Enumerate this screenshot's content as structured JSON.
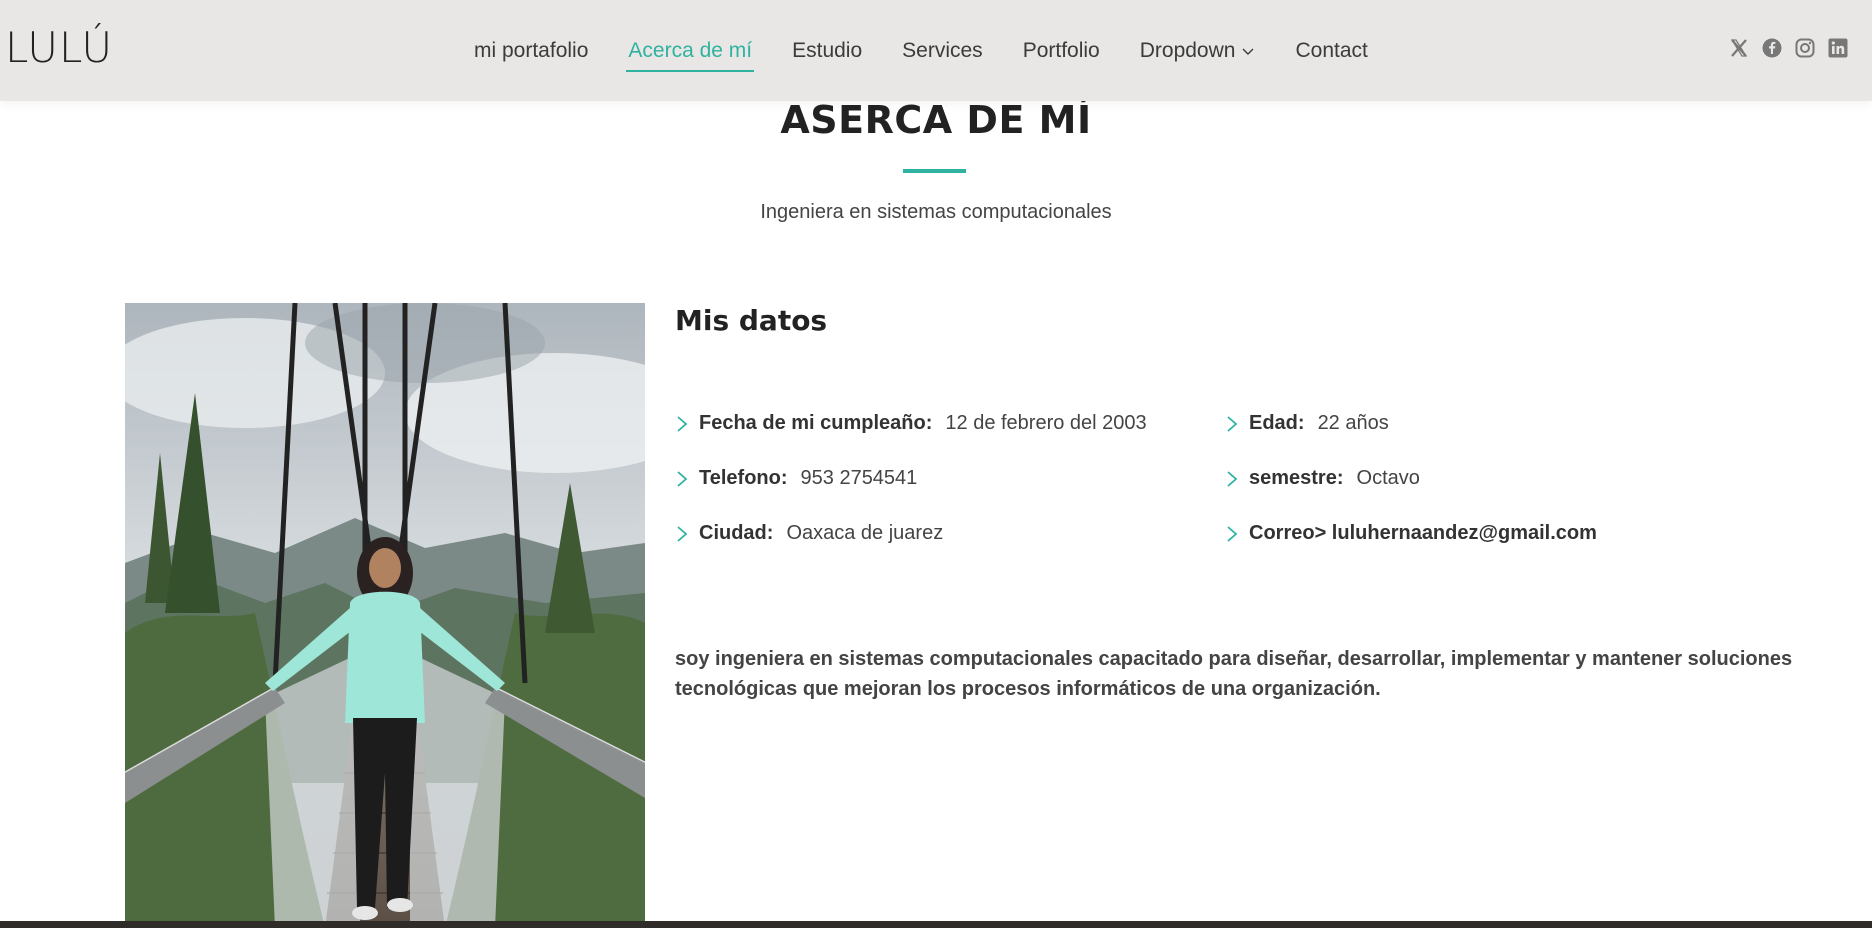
{
  "header": {
    "logo": "LULÚ",
    "nav": [
      {
        "label": "mi portafolio",
        "active": false
      },
      {
        "label": "Acerca de mí",
        "active": true
      },
      {
        "label": "Estudio",
        "active": false
      },
      {
        "label": "Services",
        "active": false
      },
      {
        "label": "Portfolio",
        "active": false
      },
      {
        "label": "Dropdown",
        "active": false,
        "icon": "chevron-down-icon"
      },
      {
        "label": "Contact",
        "active": false
      }
    ],
    "socials": [
      "x-icon",
      "facebook-icon",
      "instagram-icon",
      "linkedin-icon"
    ]
  },
  "about": {
    "title": "ASERCA DE MÍ",
    "subtitle": "Ingeniera en sistemas computacionales"
  },
  "details": {
    "heading": "Mis datos",
    "facts": {
      "birthday": {
        "label": "Fecha de mi cumpleaño:",
        "value": "12 de febrero del 2003"
      },
      "phone": {
        "label": "Telefono:",
        "value": "953 2754541"
      },
      "city": {
        "label": "Ciudad:",
        "value": "Oaxaca de juarez"
      },
      "age": {
        "label": "Edad:",
        "value": "22 años"
      },
      "semester": {
        "label": "semestre:",
        "value": "Octavo"
      },
      "email": {
        "label": "Correo> luluhernaandez@gmail.com",
        "value": ""
      }
    },
    "bio": "soy ingeniera en sistemas computacionales capacitado para diseñar, desarrollar, implementar y mantener soluciones tecnológicas que mejoran los procesos informáticos de una organización."
  },
  "colors": {
    "accent": "#2fb3a0",
    "header_bg": "#e8e7e5",
    "text": "#2b2b2b"
  }
}
